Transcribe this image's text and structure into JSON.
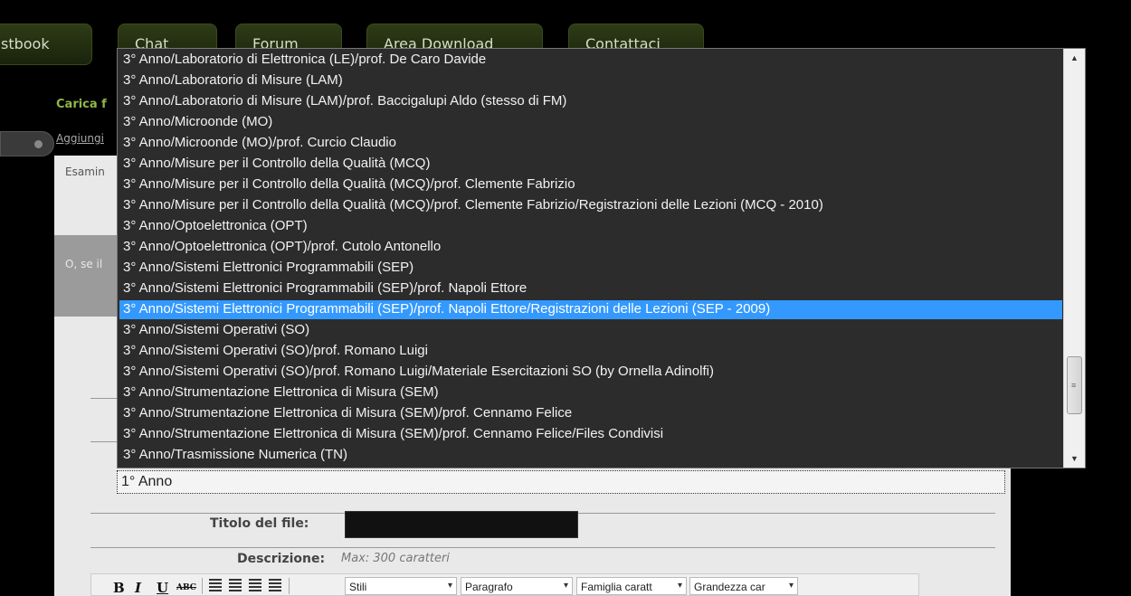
{
  "nav": {
    "tabs": [
      "stbook",
      "Chat",
      "Forum",
      "Area Download",
      "Contattaci"
    ]
  },
  "page": {
    "carica_title": "Carica f",
    "aggiungi_link": "Aggiungi",
    "esamina_text": "Esamin",
    "ose_text": "O, se il",
    "select_current": "1° Anno",
    "titolo_label": "Titolo del file:",
    "descrizione_label": "Descrizione:",
    "descrizione_hint": "Max: 300 caratteri"
  },
  "toolbar": {
    "bold": "B",
    "italic": "I",
    "underline": "U",
    "strike": "ABC",
    "stili": "Stili",
    "paragrafo": "Paragrafo",
    "famiglia": "Famiglia caratt",
    "grandezza": "Grandezza car"
  },
  "dropdown": {
    "selected_index": 12,
    "options": [
      "3° Anno/Laboratorio di Elettronica (LE)/prof. De Caro Davide",
      "3° Anno/Laboratorio di Misure (LAM)",
      "3° Anno/Laboratorio di Misure (LAM)/prof. Baccigalupi Aldo (stesso di FM)",
      "3° Anno/Microonde (MO)",
      "3° Anno/Microonde (MO)/prof. Curcio Claudio",
      "3° Anno/Misure per il Controllo della Qualità (MCQ)",
      "3° Anno/Misure per il Controllo della Qualità (MCQ)/prof. Clemente Fabrizio",
      "3° Anno/Misure per il Controllo della Qualità (MCQ)/prof. Clemente Fabrizio/Registrazioni delle Lezioni (MCQ - 2010)",
      "3° Anno/Optoelettronica (OPT)",
      "3° Anno/Optoelettronica (OPT)/prof. Cutolo Antonello",
      "3° Anno/Sistemi Elettronici Programmabili (SEP)",
      "3° Anno/Sistemi Elettronici Programmabili (SEP)/prof. Napoli Ettore",
      "3° Anno/Sistemi Elettronici Programmabili (SEP)/prof. Napoli Ettore/Registrazioni delle Lezioni (SEP - 2009)",
      "3° Anno/Sistemi Operativi (SO)",
      "3° Anno/Sistemi Operativi (SO)/prof. Romano Luigi",
      "3° Anno/Sistemi Operativi (SO)/prof. Romano Luigi/Materiale Esercitazioni SO (by Ornella Adinolfi)",
      "3° Anno/Strumentazione Elettronica di Misura (SEM)",
      "3° Anno/Strumentazione Elettronica di Misura (SEM)/prof. Cennamo Felice",
      "3° Anno/Strumentazione Elettronica di Misura (SEM)/prof. Cennamo Felice/Files Condivisi",
      "3° Anno/Trasmissione Numerica (TN)"
    ]
  },
  "colors": {
    "highlight": "#3399ff",
    "nav_tab": "#2e3b16",
    "accent_green": "#8fb64a"
  }
}
